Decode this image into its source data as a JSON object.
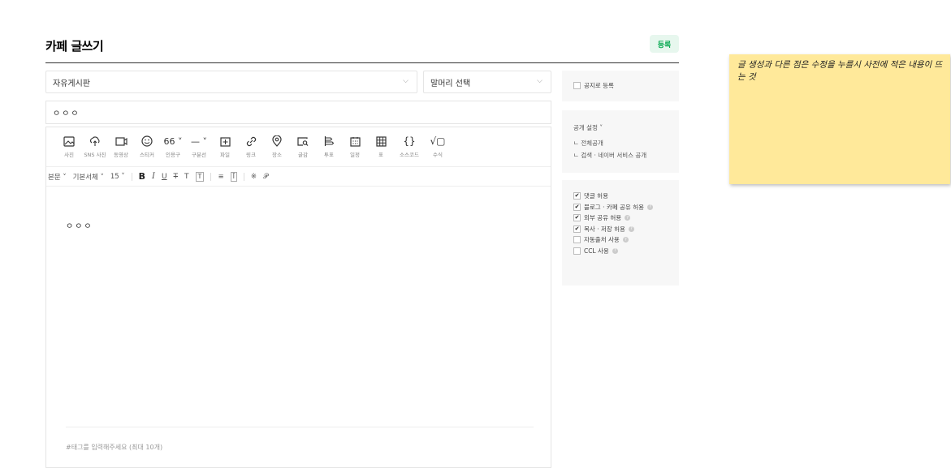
{
  "header": {
    "title": "카페 글쓰기",
    "submit_label": "등록"
  },
  "board_select": {
    "value": "자유게시판"
  },
  "prefix_select": {
    "value": "말머리 선택"
  },
  "post_title": {
    "value": "ㅇㅇㅇ"
  },
  "toolbar": {
    "tools": [
      {
        "icon": "photo-icon",
        "label": "사진"
      },
      {
        "icon": "sns-photo-icon",
        "label": "SNS 사진"
      },
      {
        "icon": "video-icon",
        "label": "동영상"
      },
      {
        "icon": "sticker-icon",
        "label": "스티커"
      },
      {
        "icon": "quote-icon",
        "glyph": "66 ˅",
        "label": "인용구"
      },
      {
        "icon": "divider-icon",
        "glyph": "— ˅",
        "label": "구분선"
      },
      {
        "icon": "file-icon",
        "label": "파일"
      },
      {
        "icon": "link-icon",
        "label": "링크"
      },
      {
        "icon": "place-icon",
        "label": "장소"
      },
      {
        "icon": "draw-icon",
        "label": "글감"
      },
      {
        "icon": "poll-icon",
        "label": "투표"
      },
      {
        "icon": "schedule-icon",
        "label": "일정"
      },
      {
        "icon": "table-icon",
        "label": "표"
      },
      {
        "icon": "code-icon",
        "glyph": "{}",
        "label": "소스코드"
      },
      {
        "icon": "formula-icon",
        "glyph": "√▢",
        "label": "수식"
      }
    ]
  },
  "format_bar": {
    "paragraph": "본문 ˅",
    "font": "기본서체 ˅",
    "size": "15 ˅",
    "bold": "B",
    "italic": "I",
    "underline": "U",
    "strike": "T",
    "color": "T",
    "background": "T",
    "align": "≡",
    "line_height": "Ī",
    "special_char": "※",
    "link": "𝒫"
  },
  "editor": {
    "body": "ㅇㅇㅇ",
    "tag_placeholder": "#태그를 입력해주세요 (최대 10개)"
  },
  "notice": {
    "label": "공지로 등록",
    "checked": false
  },
  "visibility": {
    "title": "공개 설정 ˅",
    "line1": "ㄴ 전체공개",
    "line2": "ㄴ 검색 · 네이버 서비스 공개"
  },
  "options": [
    {
      "label": "댓글 허용",
      "checked": true,
      "help": false
    },
    {
      "label": "블로그 · 카페 공유 허용",
      "checked": true,
      "help": true
    },
    {
      "label": "외부 공유 허용",
      "checked": true,
      "help": true
    },
    {
      "label": "복사 · 저장 허용",
      "checked": true,
      "help": true
    },
    {
      "label": "자동출처 사용",
      "checked": false,
      "help": true
    },
    {
      "label": "CCL 사용",
      "checked": false,
      "help": true
    }
  ],
  "sticky_note": {
    "text": "글 생성과 다른 점은 수정을 누를시 사전에 적은 내용이 뜨는 것"
  },
  "check_mark": "✔",
  "help_mark": "?",
  "colors": {
    "accent": "#03a84e",
    "accent_bg": "#e7f7ee",
    "sticky": "#ffe99a",
    "panel": "#f7f7f7"
  }
}
